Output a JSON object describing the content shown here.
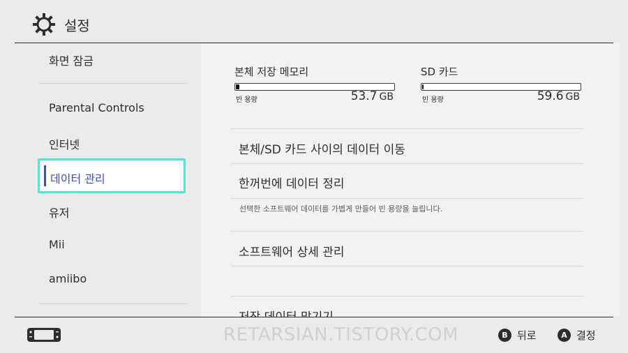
{
  "header": {
    "title": "설정",
    "icon": "gear-icon"
  },
  "sidebar": {
    "items": [
      {
        "label": "화면 잠금"
      },
      {
        "label": "Parental Controls"
      },
      {
        "label": "인터넷"
      },
      {
        "label": "데이터 관리",
        "selected": true
      },
      {
        "label": "유저"
      },
      {
        "label": "Mii"
      },
      {
        "label": "amiibo"
      }
    ]
  },
  "storage": [
    {
      "label": "본체 저장 메모리",
      "free_label": "빈 용량",
      "value": "53.7",
      "unit": "GB",
      "used_fraction": 0.02
    },
    {
      "label": "SD 카드",
      "free_label": "빈 용량",
      "value": "59.6",
      "unit": "GB",
      "used_fraction": 0.0
    }
  ],
  "menu": {
    "items": [
      {
        "label": "본체/SD 카드 사이의 데이터 이동"
      },
      {
        "label": "한꺼번에 데이터 정리",
        "description": "선택한 소프트웨어 데이터를 가볍게 만들어 빈 용량을 늘립니다."
      },
      {
        "label": "소프트웨어 상세 관리"
      },
      {
        "label": "저장 데이터 맡기기"
      }
    ]
  },
  "footer": {
    "watermark": "RETARSIAN.TISTORY.COM",
    "back": {
      "glyph": "B",
      "label": "뒤로"
    },
    "confirm": {
      "glyph": "A",
      "label": "결정"
    }
  },
  "colors": {
    "accent": "#3a4bd8",
    "highlight": "#4ee6d4",
    "background": "#ebebeb"
  }
}
